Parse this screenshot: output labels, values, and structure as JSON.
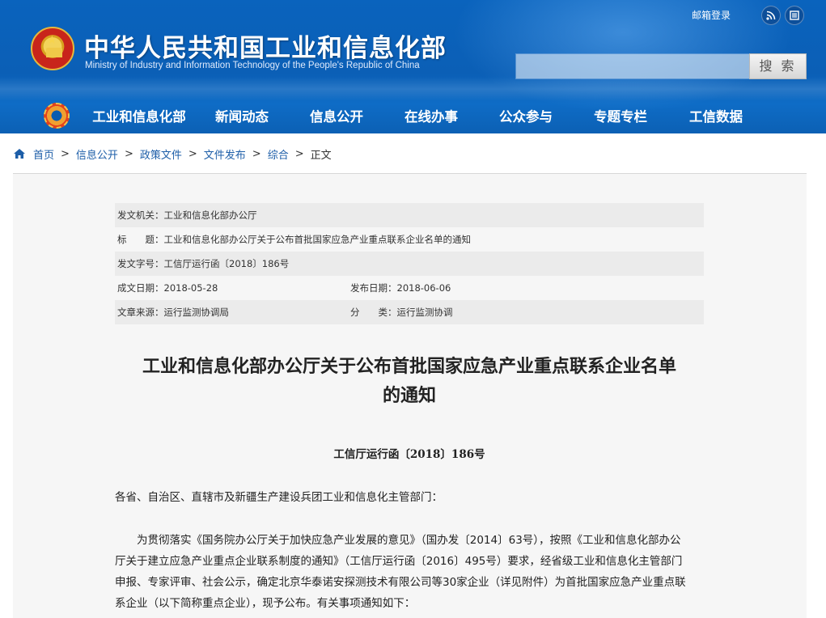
{
  "header": {
    "site_title": "中华人民共和国工业和信息化部",
    "site_subtitle": "Ministry of Industry and Information Technology of the People's Republic of China",
    "mail_login": "邮箱登录",
    "rss_icon": "rss-icon",
    "list_icon": "list-icon",
    "search_placeholder": "",
    "search_button": "搜 索"
  },
  "nav": {
    "items": [
      "工业和信息化部",
      "新闻动态",
      "信息公开",
      "在线办事",
      "公众参与",
      "专题专栏",
      "工信数据"
    ]
  },
  "breadcrumb": {
    "items": [
      "首页",
      "信息公开",
      "政策文件",
      "文件发布",
      "综合"
    ],
    "separator": ">",
    "current": "正文"
  },
  "meta": {
    "issuer_label": "发文机关：",
    "issuer": "工业和信息化部办公厅",
    "title_label": "标　　题：",
    "title": "工业和信息化部办公厅关于公布首批国家应急产业重点联系企业名单的通知",
    "doc_no_label": "发文字号：",
    "doc_no": "工信厅运行函〔2018〕186号",
    "created_label": "成文日期：",
    "created": "2018-05-28",
    "published_label": "发布日期：",
    "published": "2018-06-06",
    "source_label": "文章来源：",
    "source": "运行监测协调局",
    "category_label": "分　　类：",
    "category": "运行监测协调"
  },
  "article": {
    "title_line1": "工业和信息化部办公厅关于公布首批国家应急产业重点联系企业名单",
    "title_line2": "的通知",
    "doc_number": "工信厅运行函〔2018〕186号",
    "addressee": "各省、自治区、直辖市及新疆生产建设兵团工业和信息化主管部门：",
    "para_lines": [
      "　　为贯彻落实《国务院办公厅关于加快应急产业发展的意见》（国办发〔2014〕63号），按照《工业和信息化部办公",
      "厅关于建立应急产业重点企业联系制度的通知》（工信厅运行函〔2016〕495号）要求，经省级工业和信息化主管部门",
      "申报、专家评审、社会公示，确定北京华泰诺安探测技术有限公司等30家企业（详见附件）为首批国家应急产业重点联",
      "系企业（以下简称重点企业），现予公布。有关事项通知如下："
    ]
  },
  "colors": {
    "header_blue": "#0b5fb6",
    "link_blue": "#1d5ea8",
    "panel_bg": "#f6f6f6"
  }
}
